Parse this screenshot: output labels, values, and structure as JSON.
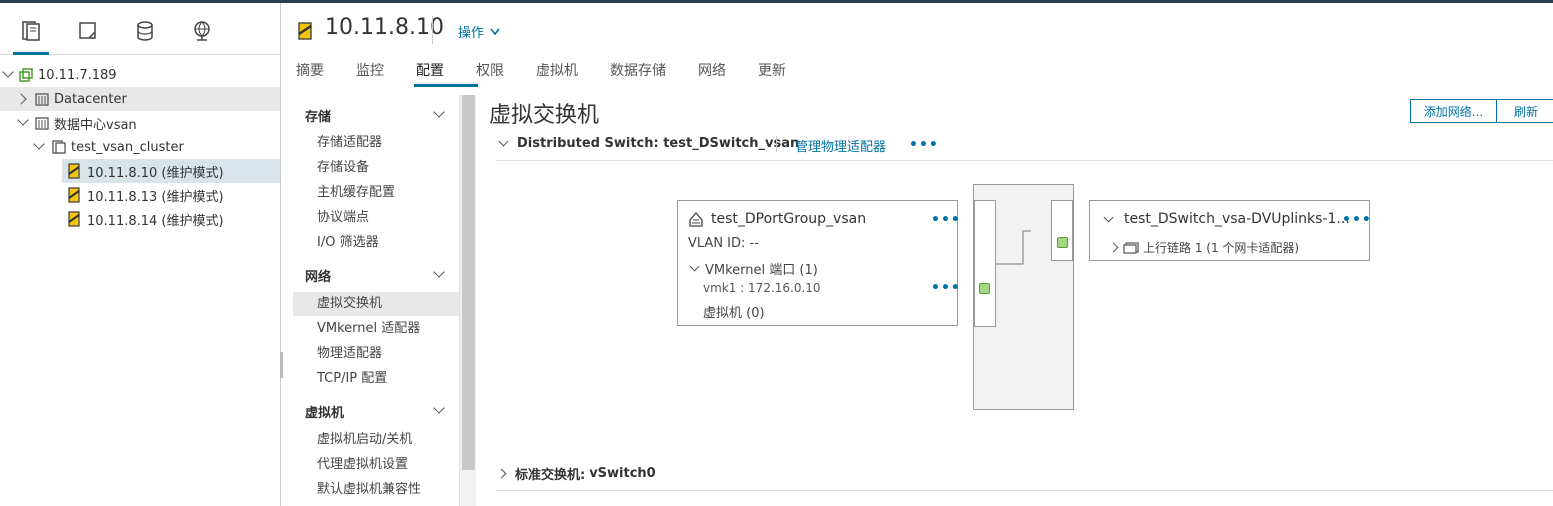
{
  "nav": {
    "tabs": [
      "hosts-and-clusters",
      "vms-and-templates",
      "storage",
      "networking"
    ],
    "tree": [
      {
        "label": "10.11.7.189",
        "icon": "vcenter-icon"
      },
      {
        "label": "Datacenter",
        "icon": "datacenter-icon"
      },
      {
        "label": "数据中心vsan",
        "icon": "datacenter-icon"
      },
      {
        "label": "test_vsan_cluster",
        "icon": "cluster-icon"
      },
      {
        "label": "10.11.8.10 (维护模式)",
        "icon": "host-maintenance-icon"
      },
      {
        "label": "10.11.8.13 (维护模式)",
        "icon": "host-maintenance-icon"
      },
      {
        "label": "10.11.8.14 (维护模式)",
        "icon": "host-maintenance-icon"
      }
    ]
  },
  "header": {
    "title": "10.11.8.10",
    "actions_label": "操作",
    "tabs": [
      "摘要",
      "监控",
      "配置",
      "权限",
      "虚拟机",
      "数据存储",
      "网络",
      "更新"
    ],
    "active_tab": "配置"
  },
  "settings": {
    "sections": [
      {
        "title": "存储",
        "items": [
          "存储适配器",
          "存储设备",
          "主机缓存配置",
          "协议端点",
          "I/O 筛选器"
        ]
      },
      {
        "title": "网络",
        "items": [
          "虚拟交换机",
          "VMkernel 适配器",
          "物理适配器",
          "TCP/IP 配置"
        ]
      },
      {
        "title": "虚拟机",
        "items": [
          "虚拟机启动/关机",
          "代理虚拟机设置",
          "默认虚拟机兼容性"
        ]
      }
    ],
    "active_item": "虚拟交换机"
  },
  "main": {
    "title": "虚拟交换机",
    "add_network_label": "添加网络...",
    "refresh_label": "刷新",
    "distributed_switch": {
      "header": "Distributed Switch: test_DSwitch_vsan",
      "manage_link": "管理物理适配器",
      "more": "•••",
      "portgroup": {
        "name": "test_DPortGroup_vsan",
        "vlan": "VLAN ID: --",
        "vmkernel_ports": "VMkernel 端口 (1)",
        "vmk": "vmk1 : 172.16.0.10",
        "vms": "虚拟机 (0)"
      },
      "uplinks": {
        "name": "test_DSwitch_vsa-DVUplinks-1...",
        "uplink": "上行链路 1 (1 个网卡适配器)"
      }
    },
    "standard_switch": {
      "label": "标准交换机:",
      "name": "vSwitch0"
    }
  },
  "colors": {
    "accent": "#0072a3",
    "port_green": "#a6d785"
  }
}
